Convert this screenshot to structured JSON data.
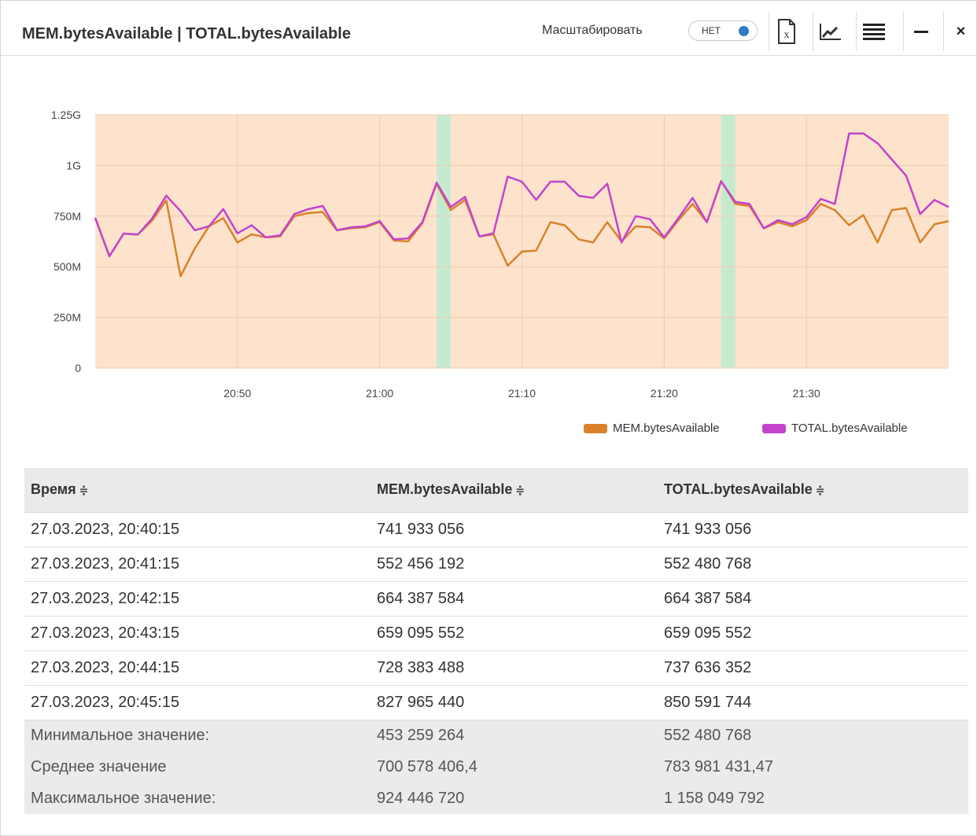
{
  "header": {
    "title": "MEM.bytesAvailable | TOTAL.bytesAvailable",
    "scale_label": "Масштабировать",
    "toggle_label": "НЕТ",
    "icons": [
      "excel-export-icon",
      "chart-icon",
      "table-menu-icon",
      "minimize-icon",
      "close-icon"
    ],
    "close_glyph": "×"
  },
  "colors": {
    "mem": "#d9822b",
    "total": "#c442cc",
    "background_band": "#fde3cc",
    "event_band": "#c6ead0"
  },
  "chart_data": {
    "type": "line",
    "x_start": "20:40",
    "x_step_minutes": 1,
    "x_ticks": [
      "20:50",
      "21:00",
      "21:10",
      "21:20",
      "21:30"
    ],
    "y_ticks": [
      "0",
      "250M",
      "500M",
      "750M",
      "1G",
      "1.25G"
    ],
    "ylim": [
      0,
      1250
    ],
    "y_unit": "M",
    "event_bands_minutes": [
      [
        24,
        25
      ],
      [
        44,
        45
      ]
    ],
    "legend_position": "bottom-right",
    "series": [
      {
        "name": "MEM.bytesAvailable",
        "values": [
          742,
          552,
          664,
          659,
          728,
          828,
          453,
          590,
          700,
          740,
          620,
          660,
          645,
          650,
          750,
          765,
          770,
          680,
          690,
          695,
          720,
          630,
          625,
          715,
          910,
          780,
          830,
          650,
          660,
          505,
          575,
          580,
          720,
          705,
          635,
          620,
          720,
          625,
          700,
          695,
          640,
          730,
          810,
          720,
          924,
          810,
          800,
          690,
          720,
          700,
          730,
          810,
          780,
          705,
          755,
          620,
          780,
          790,
          620,
          710,
          725
        ]
      },
      {
        "name": "TOTAL.bytesAvailable",
        "values": [
          742,
          552,
          664,
          659,
          738,
          851,
          775,
          680,
          700,
          785,
          665,
          705,
          645,
          655,
          760,
          785,
          800,
          680,
          695,
          700,
          725,
          635,
          640,
          720,
          915,
          795,
          845,
          650,
          665,
          945,
          920,
          830,
          920,
          920,
          850,
          840,
          910,
          620,
          750,
          735,
          645,
          740,
          840,
          720,
          922,
          820,
          810,
          690,
          730,
          710,
          745,
          835,
          810,
          1158,
          1158,
          1110,
          1030,
          950,
          760,
          830,
          795
        ]
      }
    ]
  },
  "table": {
    "columns": [
      "Время",
      "MEM.bytesAvailable",
      "TOTAL.bytesAvailable"
    ],
    "sort_glyph": "≑",
    "rows": [
      [
        "27.03.2023, 20:40:15",
        "741 933 056",
        "741 933 056"
      ],
      [
        "27.03.2023, 20:41:15",
        "552 456 192",
        "552 480 768"
      ],
      [
        "27.03.2023, 20:42:15",
        "664 387 584",
        "664 387 584"
      ],
      [
        "27.03.2023, 20:43:15",
        "659 095 552",
        "659 095 552"
      ],
      [
        "27.03.2023, 20:44:15",
        "728 383 488",
        "737 636 352"
      ],
      [
        "27.03.2023, 20:45:15",
        "827 965 440",
        "850 591 744"
      ]
    ],
    "summary": [
      [
        "Минимальное значение:",
        "453 259 264",
        "552 480 768"
      ],
      [
        "Среднее значение",
        "700 578 406,4",
        "783 981 431,47"
      ],
      [
        "Максимальное значение:",
        "924 446 720",
        "1 158 049 792"
      ]
    ]
  }
}
